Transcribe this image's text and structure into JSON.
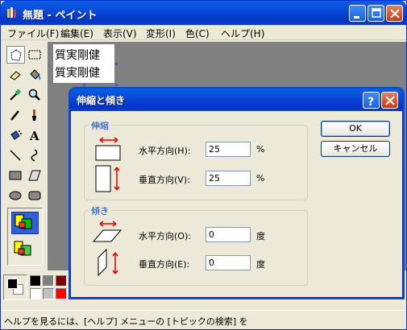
{
  "window": {
    "title": "無題 - ペイント",
    "icons": {
      "app": "paint-app-icon",
      "minimize": "minimize-icon",
      "maximize": "maximize-icon",
      "close": "close-icon"
    }
  },
  "menu": [
    {
      "label": "ファイル(F)"
    },
    {
      "label": "編集(E)"
    },
    {
      "label": "表示(V)"
    },
    {
      "label": "変形(I)"
    },
    {
      "label": "色(C)"
    },
    {
      "label": "ヘルプ(H)"
    }
  ],
  "tools": [
    "free-select-icon",
    "rect-select-icon",
    "eraser-icon",
    "fill-bucket-icon",
    "eyedropper-icon",
    "magnifier-icon",
    "pencil-icon",
    "brush-icon",
    "airbrush-icon",
    "text-tool-icon",
    "line-icon",
    "curve-icon",
    "rectangle-icon",
    "polygon-icon",
    "ellipse-icon",
    "rounded-rect-icon"
  ],
  "canvas": {
    "lines": [
      "質実剛健",
      "質実剛健"
    ]
  },
  "palette": {
    "colors": [
      "#000000",
      "#808080",
      "#800000",
      "#808000",
      "#008000",
      "#008080",
      "#000080",
      "#800080",
      "#808040",
      "#004040",
      "#0080ff",
      "#004080",
      "#8000ff",
      "#804000",
      "#ffffff",
      "#c0c0c0",
      "#ff0000",
      "#ffff00",
      "#00ff00",
      "#00ffff",
      "#0000ff",
      "#ff00ff",
      "#ffff80",
      "#00ff80",
      "#80ffff",
      "#8080ff",
      "#ff0080",
      "#ff8040"
    ]
  },
  "status": {
    "text": "ヘルプを見るには、[ヘルプ] メニューの [トピックの検索] を"
  },
  "dialog": {
    "title": "伸縮と傾き",
    "stretch_group": "伸縮",
    "skew_group": "傾き",
    "stretch_h_label": "水平方向(H):",
    "stretch_h_value": "25",
    "stretch_v_label": "垂直方向(V):",
    "stretch_v_value": "25",
    "skew_h_label": "水平方向(O):",
    "skew_h_value": "0",
    "skew_v_label": "垂直方向(E):",
    "skew_v_value": "0",
    "percent": "%",
    "degree": "度",
    "ok": "OK",
    "cancel": "キャンセル",
    "help_icon": "help-icon",
    "close_icon": "close-icon"
  }
}
